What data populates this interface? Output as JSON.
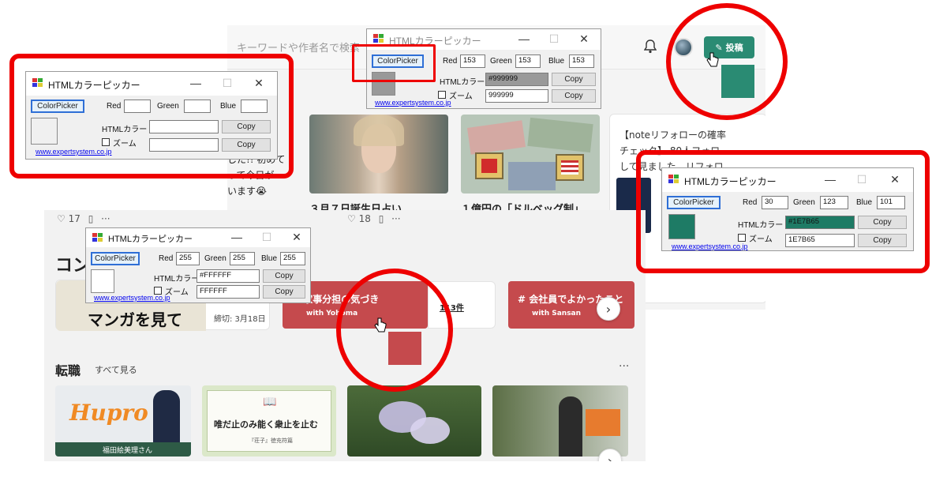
{
  "note_page": {
    "search_placeholder": "キーワードや作者名で検索",
    "post_button": "投稿",
    "side_text": [
      "【noteリフォローの確率",
      "チェック】 80人フォロ",
      "して見ました。リフォロ…"
    ],
    "left_text": [
      "した!! 初めて",
      "って今日が",
      "います😭"
    ],
    "headline_1": "３月７日誕生日占い",
    "headline_2": "１億円の「ドルベッグ制」",
    "like_count": "18"
  },
  "bottom_page": {
    "like_count": "17",
    "section_title": "コン",
    "manga_caption": "マンガを見て",
    "deadline": "締切: 3月18日",
    "tag_card_1": {
      "title": "# 家事分担の気づき",
      "sub": "with Yohoma",
      "count": "113件"
    },
    "tag_card_2": {
      "title": "# 会社員でよかったこと",
      "sub": "with Sansan"
    },
    "jobs_title": "転職",
    "see_all": "すべて見る",
    "thumb_logo": "Hupro",
    "thumb_person": "福田絵美理さん",
    "book_text": "唯だ止のみ能く衆止を止む",
    "book_sub": "『荘子』徳充符篇"
  },
  "common": {
    "window_title": "HTMLカラーピッカー",
    "colorpicker_label": "ColorPicker",
    "red_label": "Red",
    "green_label": "Green",
    "blue_label": "Blue",
    "html_label": "HTMLカラー",
    "zoom_label": "ズーム",
    "copy_label": "Copy",
    "link_text": "www.expertsystem.co.jp",
    "minimize": "—",
    "maximize": "☐",
    "close": "✕"
  },
  "pickers": {
    "empty": {
      "red": "",
      "green": "",
      "blue": "",
      "html": "",
      "hex": "",
      "color": "#f0f0f0"
    },
    "gray": {
      "red": "153",
      "green": "153",
      "blue": "153",
      "html": "#999999",
      "hex": "999999",
      "color": "#999999"
    },
    "green": {
      "red": "30",
      "green": "123",
      "blue": "101",
      "html": "#1E7B65",
      "hex": "1E7B65",
      "color": "#1E7B65"
    },
    "white": {
      "red": "255",
      "green": "255",
      "blue": "255",
      "html": "#FFFFFF",
      "hex": "FFFFFF",
      "color": "#FFFFFF"
    }
  },
  "colors": {
    "annotation_red": "#ee0000",
    "note_green": "#2a8b73",
    "tag_red": "#c54a4d",
    "sampled_red": "#c54a4d"
  }
}
